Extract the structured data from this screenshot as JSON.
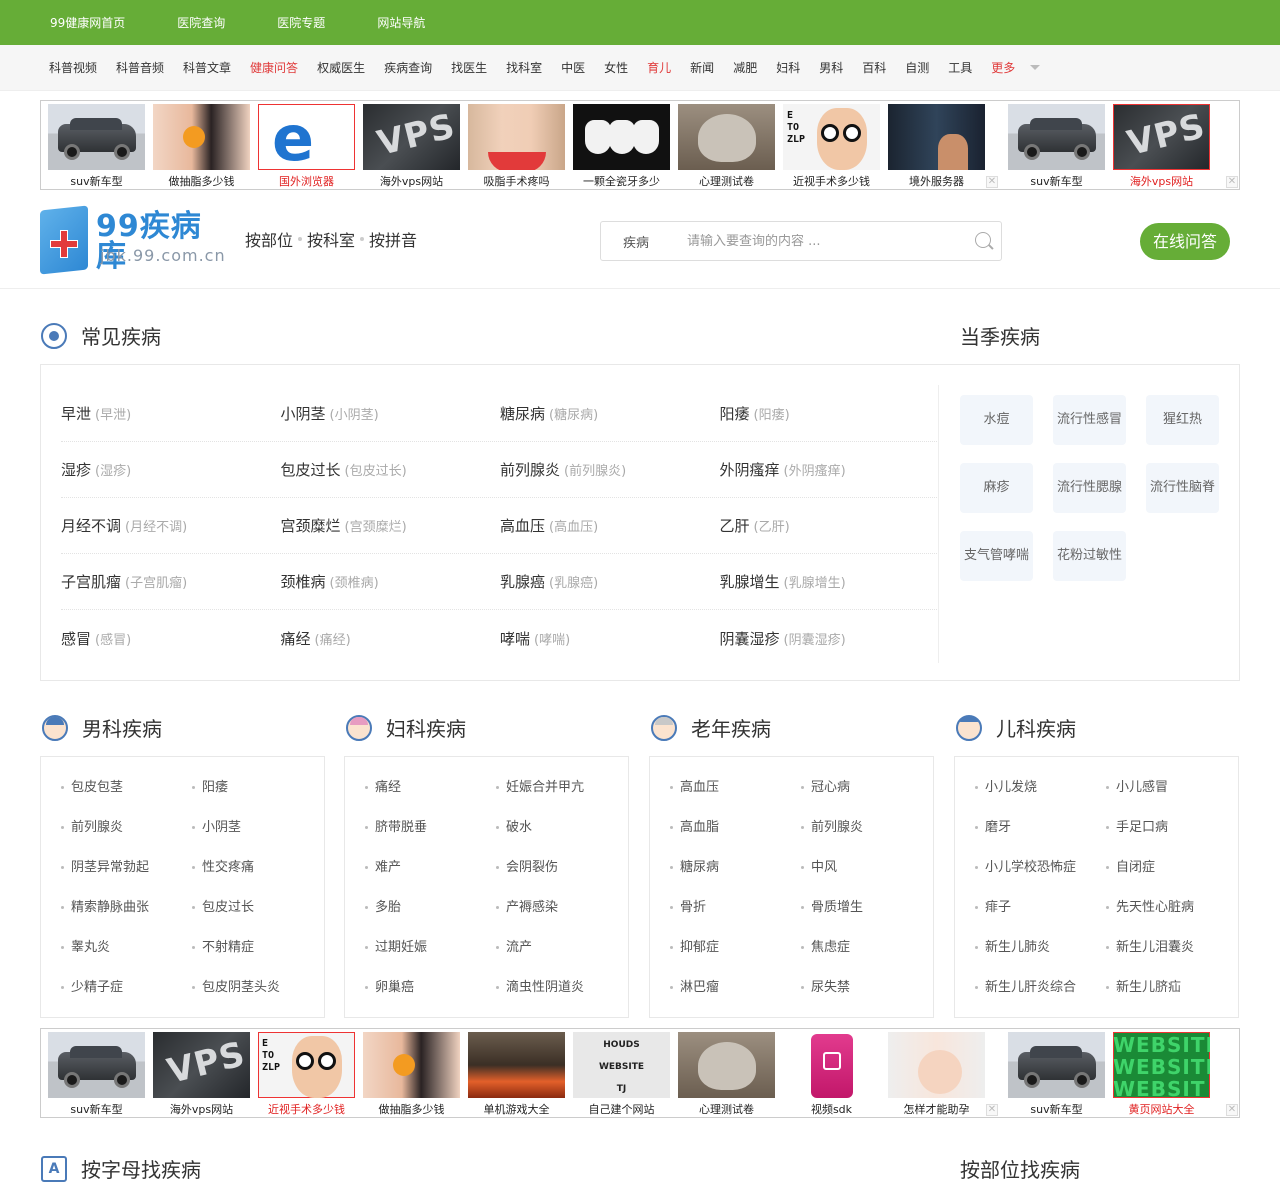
{
  "topbar": [
    "99健康网首页",
    "医院查询",
    "医院专题",
    "网站导航"
  ],
  "nav": [
    {
      "label": "科普视频",
      "red": false
    },
    {
      "label": "科普音频",
      "red": false
    },
    {
      "label": "科普文章",
      "red": false
    },
    {
      "label": "健康问答",
      "red": true
    },
    {
      "label": "权威医生",
      "red": false
    },
    {
      "label": "疾病查询",
      "red": false
    },
    {
      "label": "找医生",
      "red": false
    },
    {
      "label": "找科室",
      "red": false
    },
    {
      "label": "中医",
      "red": false
    },
    {
      "label": "女性",
      "red": false
    },
    {
      "label": "育儿",
      "red": true
    },
    {
      "label": "新闻",
      "red": false
    },
    {
      "label": "减肥",
      "red": false
    },
    {
      "label": "妇科",
      "red": false
    },
    {
      "label": "男科",
      "red": false
    },
    {
      "label": "百科",
      "red": false
    },
    {
      "label": "自测",
      "red": false
    },
    {
      "label": "工具",
      "red": false
    },
    {
      "label": "更多",
      "red": true
    }
  ],
  "ads_top": {
    "main": [
      {
        "cap": "suv新车型",
        "pic": "car",
        "red": false
      },
      {
        "cap": "做抽脂多少钱",
        "pic": "leg",
        "red": false
      },
      {
        "cap": "国外浏览器",
        "pic": "e",
        "red": true
      },
      {
        "cap": "海外vps网站",
        "pic": "vps",
        "red": false
      },
      {
        "cap": "吸脂手术疼吗",
        "pic": "belly",
        "red": false
      },
      {
        "cap": "一颗全瓷牙多少",
        "pic": "teeth",
        "red": false
      },
      {
        "cap": "心理测试卷",
        "pic": "puff",
        "red": false
      },
      {
        "cap": "近视手术多少钱",
        "pic": "kid",
        "red": false
      },
      {
        "cap": "境外服务器",
        "pic": "server",
        "red": false
      }
    ],
    "side": [
      {
        "cap": "suv新车型",
        "pic": "car",
        "red": false
      },
      {
        "cap": "海外vps网站",
        "pic": "vps",
        "red": true
      }
    ]
  },
  "ads_bottom": {
    "main": [
      {
        "cap": "suv新车型",
        "pic": "car",
        "red": false
      },
      {
        "cap": "海外vps网站",
        "pic": "vps",
        "red": false
      },
      {
        "cap": "近视手术多少钱",
        "pic": "kid",
        "red": true
      },
      {
        "cap": "做抽脂多少钱",
        "pic": "leg",
        "red": false
      },
      {
        "cap": "单机游戏大全",
        "pic": "fire",
        "red": false
      },
      {
        "cap": "自己建个网站",
        "pic": "blocks",
        "red": false
      },
      {
        "cap": "心理测试卷",
        "pic": "puff",
        "red": false
      },
      {
        "cap": "视频sdk",
        "pic": "video",
        "red": false
      },
      {
        "cap": "怎样才能助孕",
        "pic": "preg",
        "red": false
      }
    ],
    "side": [
      {
        "cap": "suv新车型",
        "pic": "car",
        "red": false
      },
      {
        "cap": "黄页网站大全",
        "pic": "web",
        "red": true
      }
    ]
  },
  "ad_text": {
    "vps": "VPS",
    "e": "e",
    "eye_chart": "E TO ZLP",
    "blocks": [
      "HOUDS",
      "WEBSITE",
      "TJ"
    ],
    "web": [
      "WEBSITE",
      "WEBSITE",
      "WEBSIT"
    ]
  },
  "header": {
    "logo_name": "99疾病库",
    "logo_domain": "jbk.99.com.cn",
    "browse": [
      "按部位",
      "按科室",
      "按拼音"
    ],
    "search_type": "疾病",
    "search_placeholder": "请输入要查询的内容 ...",
    "ask_button": "在线问答"
  },
  "common": {
    "title": "常见疾病",
    "rows": [
      [
        {
          "n": "早泄",
          "a": "(早泄)"
        },
        {
          "n": "小阴茎",
          "a": "(小阴茎)"
        },
        {
          "n": "糖尿病",
          "a": "(糖尿病)"
        },
        {
          "n": "阳痿",
          "a": "(阳痿)"
        }
      ],
      [
        {
          "n": "湿疹",
          "a": "(湿疹)"
        },
        {
          "n": "包皮过长",
          "a": "(包皮过长)"
        },
        {
          "n": "前列腺炎",
          "a": "(前列腺炎)"
        },
        {
          "n": "外阴瘙痒",
          "a": "(外阴瘙痒)"
        }
      ],
      [
        {
          "n": "月经不调",
          "a": "(月经不调)"
        },
        {
          "n": "宫颈糜烂",
          "a": "(宫颈糜烂)"
        },
        {
          "n": "高血压",
          "a": "(高血压)"
        },
        {
          "n": "乙肝",
          "a": "(乙肝)"
        }
      ],
      [
        {
          "n": "子宫肌瘤",
          "a": "(子宫肌瘤)"
        },
        {
          "n": "颈椎病",
          "a": "(颈椎病)"
        },
        {
          "n": "乳腺癌",
          "a": "(乳腺癌)"
        },
        {
          "n": "乳腺增生",
          "a": "(乳腺增生)"
        }
      ],
      [
        {
          "n": "感冒",
          "a": "(感冒)"
        },
        {
          "n": "痛经",
          "a": "(痛经)"
        },
        {
          "n": "哮喘",
          "a": "(哮喘)"
        },
        {
          "n": "阴囊湿疹",
          "a": "(阴囊湿疹)"
        }
      ]
    ]
  },
  "season": {
    "title": "当季疾病",
    "items": [
      "水痘",
      "流行性感冒",
      "猩红热",
      "麻疹",
      "流行性腮腺",
      "流行性脑脊",
      "支气管哮喘",
      "花粉过敏性"
    ]
  },
  "categories": [
    {
      "title": "男科疾病",
      "icon": "male-face-icon",
      "items": [
        "包皮包茎",
        "阳痿",
        "前列腺炎",
        "小阴茎",
        "阴茎异常勃起",
        "性交疼痛",
        "精索静脉曲张",
        "包皮过长",
        "睾丸炎",
        "不射精症",
        "少精子症",
        "包皮阴茎头炎"
      ]
    },
    {
      "title": "妇科疾病",
      "icon": "female-face-icon",
      "items": [
        "痛经",
        "妊娠合并甲亢",
        "脐带脱垂",
        "破水",
        "难产",
        "会阴裂伤",
        "多胎",
        "产褥感染",
        "过期妊娠",
        "流产",
        "卵巢癌",
        "滴虫性阴道炎"
      ]
    },
    {
      "title": "老年疾病",
      "icon": "elder-face-icon",
      "items": [
        "高血压",
        "冠心病",
        "高血脂",
        "前列腺炎",
        "糖尿病",
        "中风",
        "骨折",
        "骨质增生",
        "抑郁症",
        "焦虑症",
        "淋巴瘤",
        "尿失禁"
      ]
    },
    {
      "title": "儿科疾病",
      "icon": "child-face-icon",
      "items": [
        "小儿发烧",
        "小儿感冒",
        "磨牙",
        "手足口病",
        "小儿学校恐怖症",
        "自闭症",
        "痱子",
        "先天性心脏病",
        "新生儿肺炎",
        "新生儿泪囊炎",
        "新生儿肝炎综合",
        "新生儿脐疝"
      ]
    }
  ],
  "bottom": {
    "left_title": "按字母找疾病",
    "left_icon": "A",
    "right_title": "按部位找疾病"
  },
  "colors": {
    "brand_green": "#66ad37",
    "brand_blue": "#2e88d4",
    "accent_red": "#e03a3a"
  }
}
